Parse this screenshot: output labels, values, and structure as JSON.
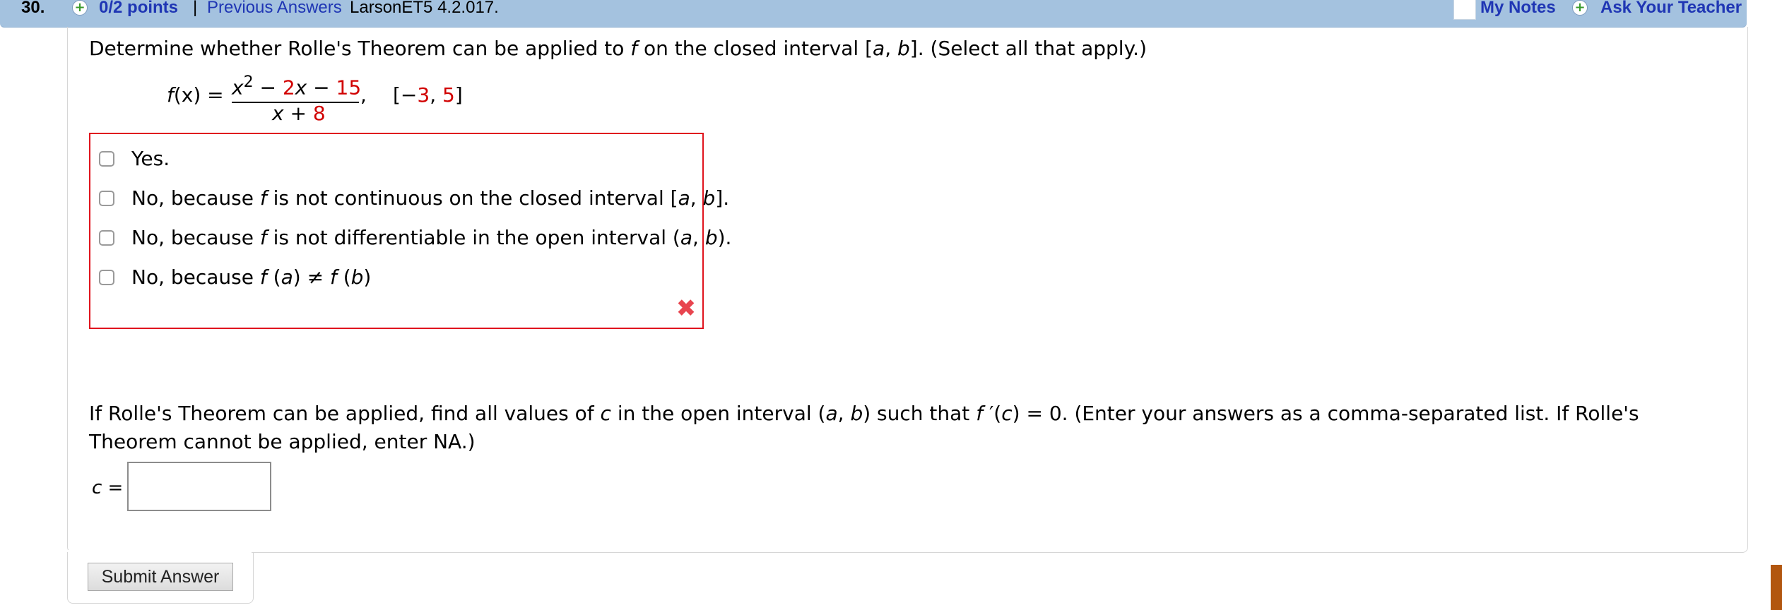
{
  "header": {
    "question_number": "30.",
    "points": "0/2 points",
    "separator": "|",
    "previous_answers": "Previous Answers",
    "problem_code": "LarsonET5 4.2.017.",
    "my_notes": "My Notes",
    "ask_teacher": "Ask Your Teacher",
    "plus_glyph": "+"
  },
  "question1": {
    "pre": "Determine whether Rolle's Theorem can be applied to ",
    "f": "f",
    "mid": " on the closed interval [",
    "a": "a",
    "comma": ", ",
    "b": "b",
    "post": "]. (Select all that apply.)"
  },
  "formula": {
    "lhs_f": "f",
    "lhs_rest": "(x) =",
    "num_x": "x",
    "num_exp": "2",
    "num_minus1": " − ",
    "num_2x_coef": "2",
    "num_2x_var": "x",
    "num_minus2": " − ",
    "num_15": "15",
    "den_x": "x",
    "den_plus": " + ",
    "den_8": "8",
    "comma": ",",
    "interval_open": "[−",
    "interval_a": "3",
    "interval_comma": ", ",
    "interval_b": "5",
    "interval_close": "]"
  },
  "options": [
    {
      "label_pre": "Yes.",
      "checked": false
    },
    {
      "label_pre": "No, because ",
      "f": "f",
      "label_mid": " is not continuous on the closed interval [",
      "a": "a",
      "comma": ", ",
      "b": "b",
      "label_post": "].",
      "checked": false
    },
    {
      "label_pre": "No, because ",
      "f": "f",
      "label_mid": " is not differentiable in the open interval (",
      "a": "a",
      "comma": ", ",
      "b": "b",
      "label_post": ").",
      "checked": false
    },
    {
      "label_pre": "No, because ",
      "f1": "f",
      "p1": " (",
      "a": "a",
      "p2": ") ≠ ",
      "f2": "f",
      "p3": " (",
      "b": "b",
      "p4": ")",
      "checked": false
    }
  ],
  "incorrect_mark": "✖",
  "question2": {
    "pre": "If Rolle's Theorem can be applied, find all values of ",
    "c": "c",
    "mid1": " in the open interval (",
    "a": "a",
    "comma": ", ",
    "b": "b",
    "mid2": ") such that ",
    "f": "f",
    "mid3": " ′(",
    "c2": "c",
    "post": ") = 0. (Enter your answers as a comma-separated list. If Rolle's Theorem cannot be applied, enter NA.)"
  },
  "answer": {
    "label": "c =",
    "value": ""
  },
  "submit_label": "Submit Answer",
  "colors": {
    "header_bg": "#a4c2df",
    "link": "#1f36b4",
    "red": "#d10000",
    "box_border": "#e0141e"
  }
}
